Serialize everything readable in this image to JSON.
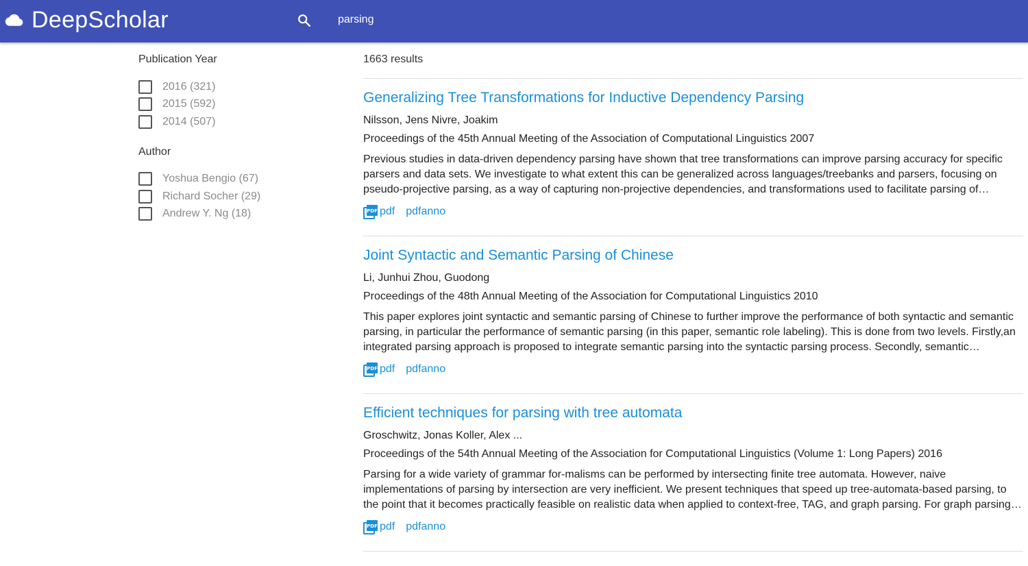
{
  "header": {
    "brand": "DeepScholar",
    "brand_icon": "cloud-icon",
    "search_icon": "search-icon",
    "search_value": "parsing",
    "background_color": "#3f51b5"
  },
  "sidebar": {
    "facets": [
      {
        "title": "Publication Year",
        "options": [
          {
            "label": "2016 (321)",
            "checked": false
          },
          {
            "label": "2015 (592)",
            "checked": false
          },
          {
            "label": "2014 (507)",
            "checked": false
          }
        ]
      },
      {
        "title": "Author",
        "options": [
          {
            "label": "Yoshua Bengio (67)",
            "checked": false
          },
          {
            "label": "Richard Socher (29)",
            "checked": false
          },
          {
            "label": "Andrew Y. Ng (18)",
            "checked": false
          }
        ]
      }
    ]
  },
  "results": {
    "count_label": "1663 results",
    "link_color": "#1a8fd6",
    "items": [
      {
        "title": "Generalizing Tree Transformations for Inductive Dependency Parsing",
        "authors": "Nilsson, Jens Nivre, Joakim",
        "venue": "Proceedings of the 45th Annual Meeting of the Association of Computational Linguistics 2007",
        "abstract": "Previous studies in data-driven dependency parsing have shown that tree transformations can improve parsing accuracy for specific parsers and data sets. We investigate to what extent this can be generalized across languages/treebanks and parsers, focusing on pseudo-projective parsing, as a way of capturing non-projective dependencies, and transformations used to facilitate parsing of coordinate structures and verb groups.",
        "pdf_label": "pdf",
        "pdfanno_label": "pdfanno"
      },
      {
        "title": "Joint Syntactic and Semantic Parsing of Chinese",
        "authors": "Li, Junhui Zhou, Guodong",
        "venue": "Proceedings of the 48th Annual Meeting of the Association for Computational Linguistics 2010",
        "abstract": "This paper explores joint syntactic and semantic parsing of Chinese to further improve the performance of both syntactic and semantic parsing, in particular the performance of semantic parsing (in this paper, semantic role labeling). This is done from two levels. Firstly,an integrated parsing approach is proposed to integrate semantic parsing into the syntactic parsing process. Secondly, semantic information generated by semantic parsing is incorporated into the syntactic parsing model.",
        "pdf_label": "pdf",
        "pdfanno_label": "pdfanno"
      },
      {
        "title": "Efficient techniques for parsing with tree automata",
        "authors": "Groschwitz, Jonas Koller, Alex ...",
        "venue": "Proceedings of the 54th Annual Meeting of the Association for Computational Linguistics (Volume 1: Long Papers) 2016",
        "abstract": "Parsing for a wide variety of grammar for-malisms can be performed by intersecting finite tree automata. However, naive implementations of parsing by intersection are very inefficient. We present techniques that speed up tree-automata-based parsing, to the point that it becomes practically feasible on realistic data when applied to context-free, TAG, and graph parsing. For graph parsing, we obtain the best runtimes in the literature.",
        "pdf_label": "pdf",
        "pdfanno_label": "pdfanno"
      }
    ]
  }
}
